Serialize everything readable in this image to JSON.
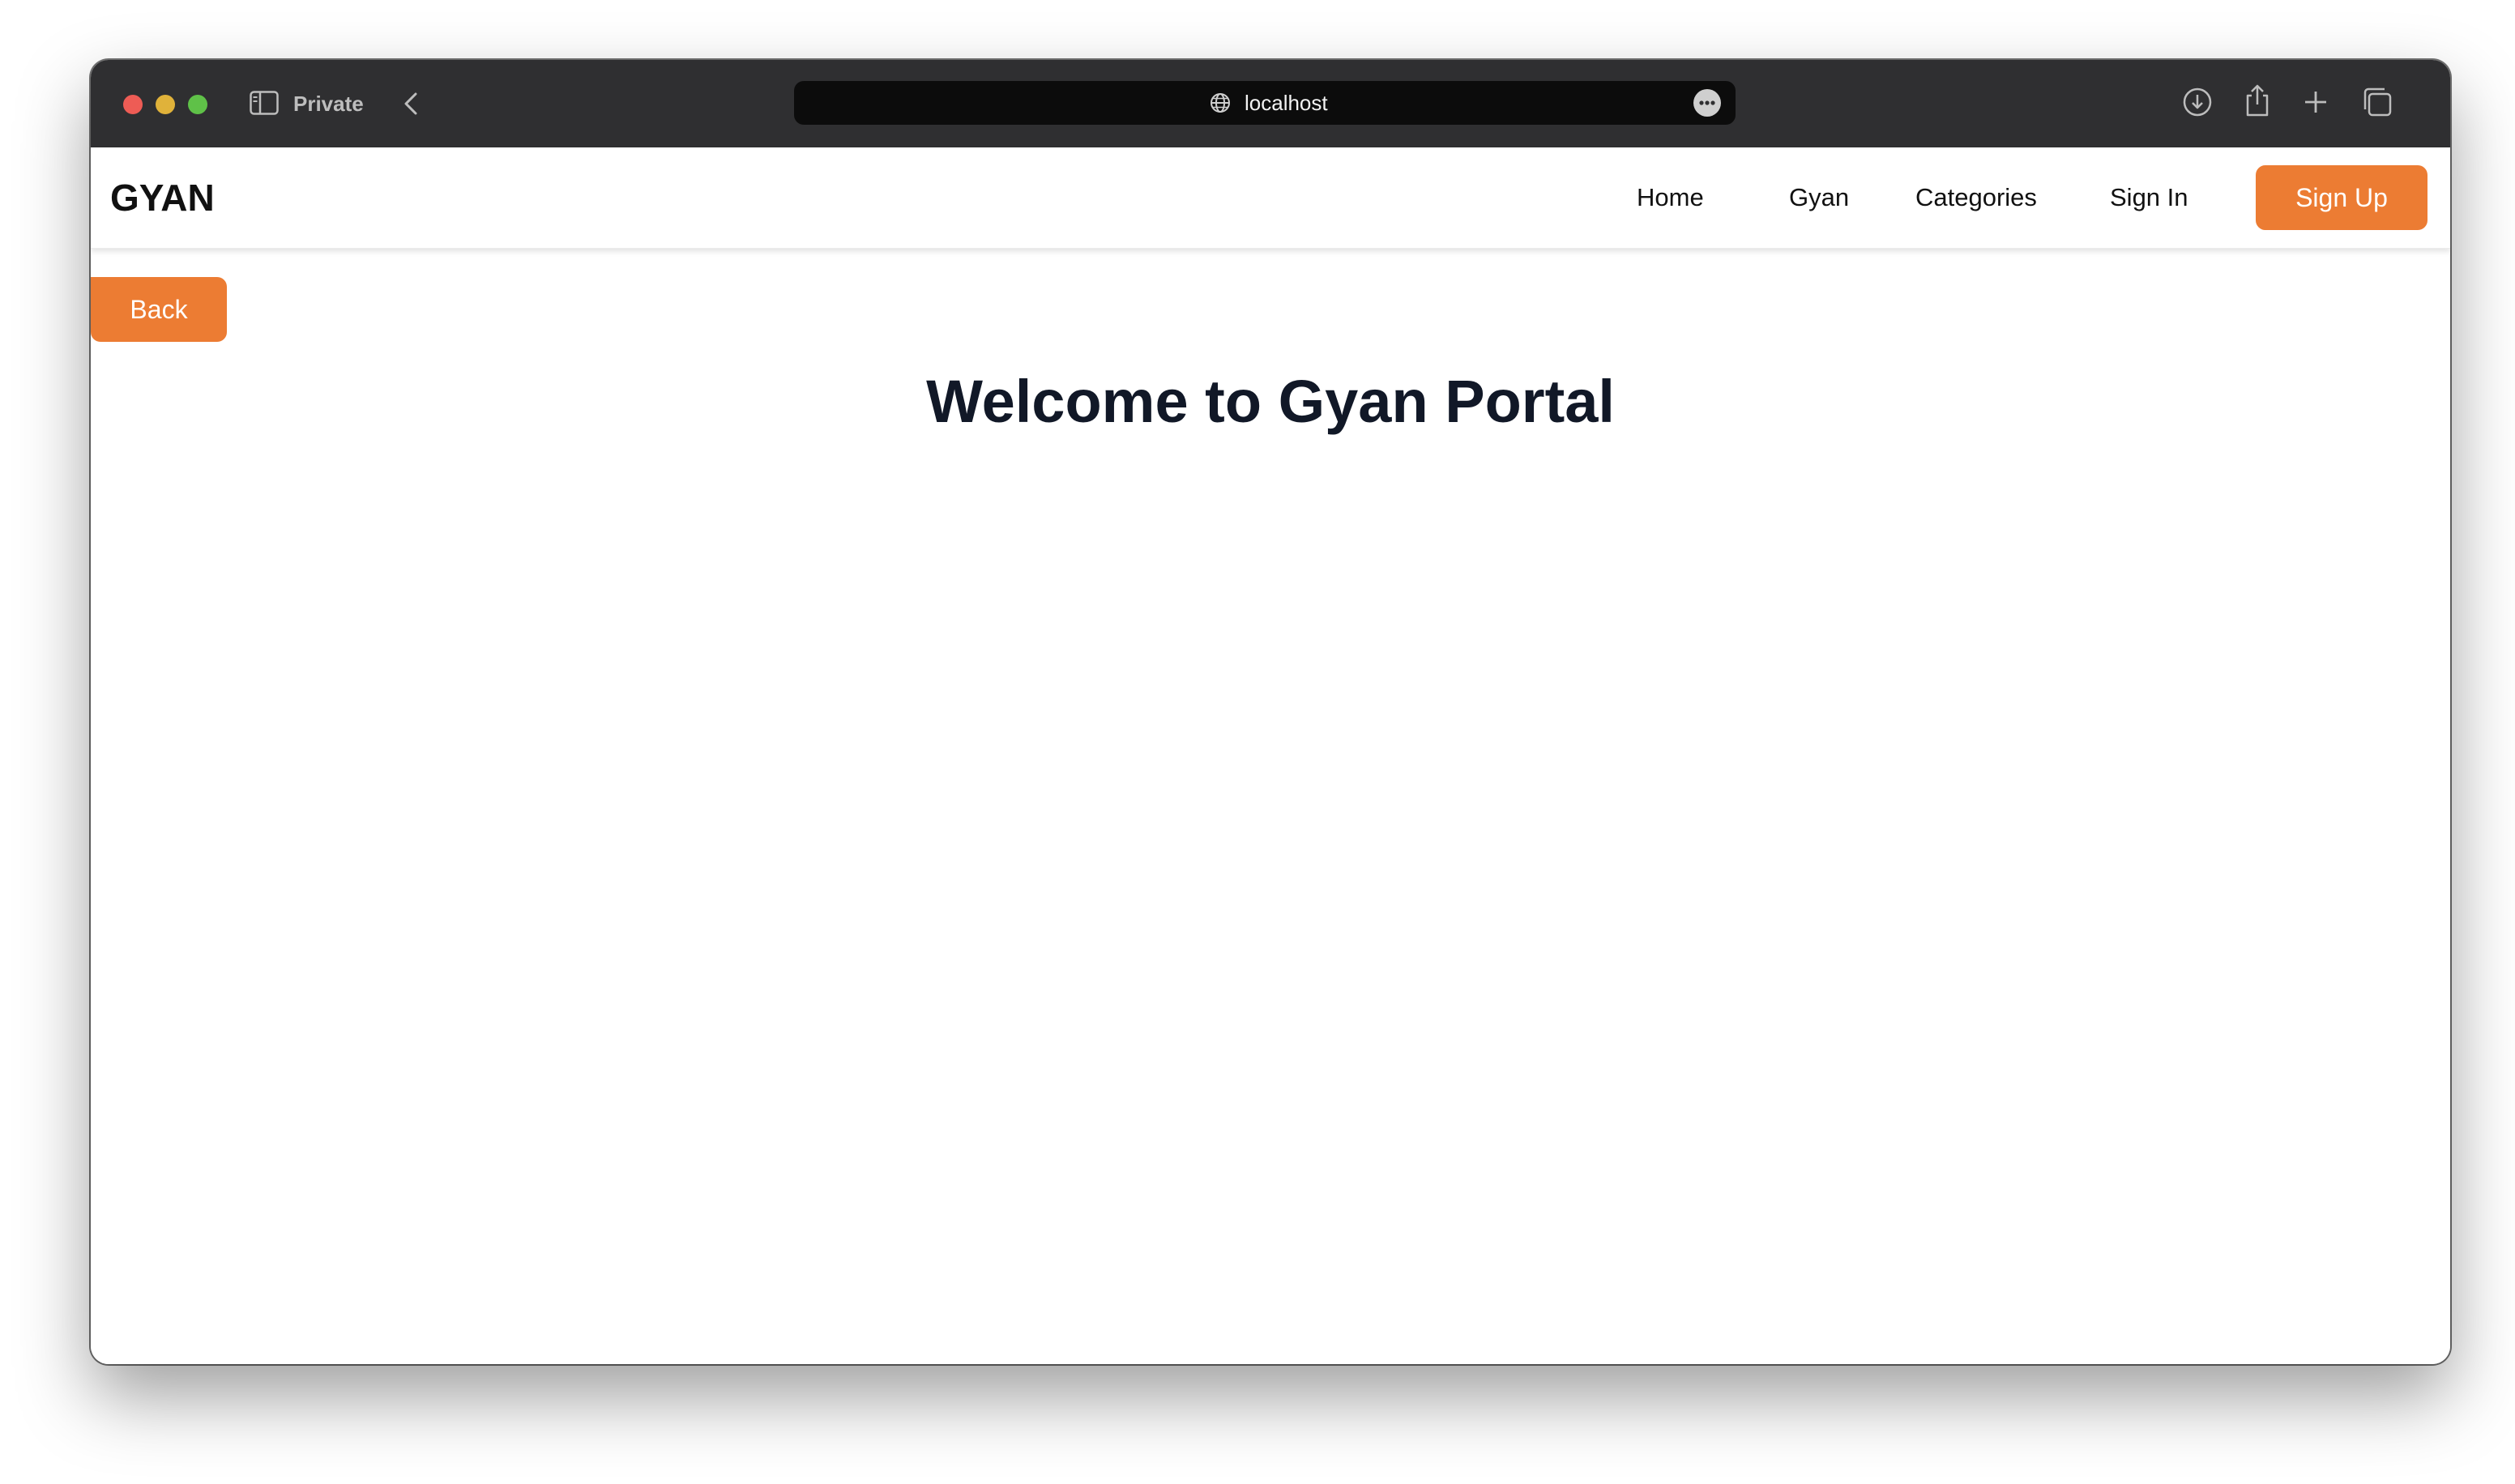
{
  "browser": {
    "mode_label": "Private",
    "url": "localhost"
  },
  "navbar": {
    "logo": "GYAN",
    "links": [
      "Home",
      "Gyan",
      "Categories",
      "Sign In"
    ],
    "signup_label": "Sign Up"
  },
  "main": {
    "back_label": "Back",
    "title": "Welcome to Gyan Portal"
  },
  "colors": {
    "accent": "#ec7c33",
    "title": "#111827",
    "toolbar": "#2f2f31"
  }
}
